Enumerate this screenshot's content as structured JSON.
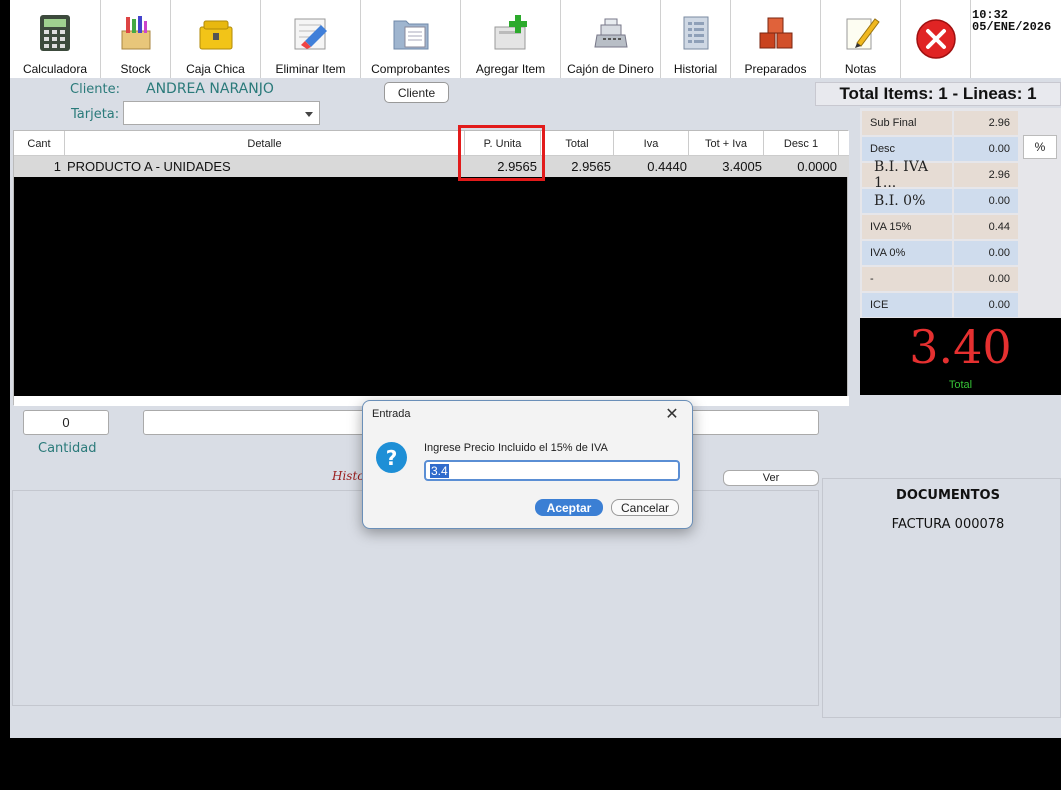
{
  "toolbar": {
    "buttons": [
      {
        "label": "Calculadora",
        "icon": "calculator-icon"
      },
      {
        "label": "Stock",
        "icon": "stock-box-icon"
      },
      {
        "label": "Caja Chica",
        "icon": "cash-box-icon"
      },
      {
        "label": "Eliminar Item",
        "icon": "eraser-icon"
      },
      {
        "label": "Comprobantes",
        "icon": "folder-documents-icon"
      },
      {
        "label": "Agregar Item",
        "icon": "add-item-icon"
      },
      {
        "label": "Cajón de Dinero",
        "icon": "cash-register-icon"
      },
      {
        "label": "Historial",
        "icon": "history-ledger-icon"
      },
      {
        "label": "Preparados",
        "icon": "boxes-icon"
      },
      {
        "label": "Notas",
        "icon": "note-pencil-icon"
      }
    ],
    "close_icon": "close-icon",
    "time": "10:32",
    "date": "05/ENE/2026"
  },
  "client": {
    "label": "Cliente:",
    "name": "ANDREA NARANJO",
    "card_label": "Tarjeta:",
    "card_value": "",
    "client_button": "Cliente"
  },
  "summary": {
    "total_items": "Total Items: 1 - Lineas: 1"
  },
  "grid": {
    "headers": [
      "Cant",
      "Detalle",
      "P. Unita",
      "Total",
      "Iva",
      "Tot + Iva",
      "Desc 1"
    ],
    "rows": [
      {
        "cant": "1",
        "detalle": "PRODUCTO A  - UNIDADES",
        "p_unita": "2.9565",
        "total": "2.9565",
        "iva": "0.4440",
        "tot_iva": "3.4005",
        "desc1": "0.0000"
      }
    ]
  },
  "totals": {
    "rows": [
      {
        "label": "Sub Final",
        "value": "2.96"
      },
      {
        "label": "Desc",
        "value": "0.00"
      },
      {
        "label": "B.I. IVA 1...",
        "value": "2.96"
      },
      {
        "label": "B.I. 0%",
        "value": "0.00"
      },
      {
        "label": "IVA 15%",
        "value": "0.44"
      },
      {
        "label": "IVA 0%",
        "value": "0.00"
      },
      {
        "label": "-",
        "value": "0.00"
      },
      {
        "label": "ICE",
        "value": "0.00"
      }
    ],
    "percent_button": "%",
    "grand_total": "3.40",
    "grand_total_label": "Total"
  },
  "entry": {
    "quantity": "0",
    "quantity_label": "Cantidad",
    "history_label": "Histo",
    "ver_button": "Ver"
  },
  "documents": {
    "title": "DOCUMENTOS",
    "item": "FACTURA  000078"
  },
  "dialog": {
    "title": "Entrada",
    "close": "✕",
    "icon": "question-icon",
    "message": "Ingrese Precio Incluido el 15% de IVA",
    "input_value": "3.4",
    "ok": "Aceptar",
    "cancel": "Cancelar"
  },
  "colors": {
    "highlight": "#e21b1b",
    "total_red": "#e53030",
    "teal_text": "#2a7a7a",
    "accent_blue": "#3b7fd4"
  }
}
